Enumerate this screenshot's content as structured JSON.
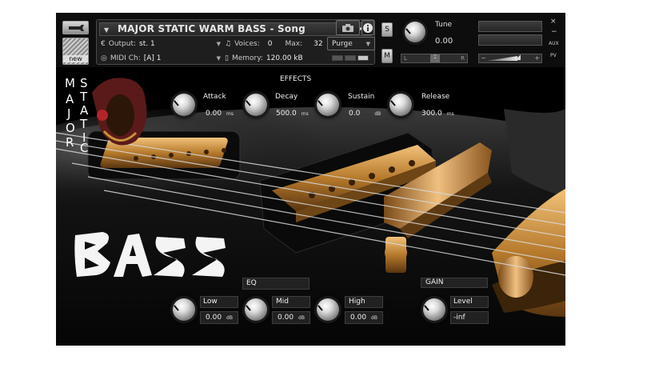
{
  "colors": {
    "accent_gold": "#c8923a",
    "panel_bg": "#1e1e1e",
    "text": "#f0f0f0"
  },
  "header": {
    "wrench_icon": "wrench-icon",
    "new_label": "new",
    "title": "MAJOR STATIC WARM BASS - Song",
    "output_label": "Output:",
    "output_value": "st. 1",
    "voices_label": "Voices:",
    "voices_value": "0",
    "max_label": "Max:",
    "max_value": "32",
    "purge_label": "Purge",
    "midi_label": "MIDI Ch:",
    "midi_value": "[A]  1",
    "memory_label": "Memory:",
    "memory_value": "120.00 kB",
    "solo_label": "S",
    "mute_label": "M",
    "tune_label": "Tune",
    "tune_value": "0.00",
    "pan_left": "L",
    "pan_right": "R",
    "aux_label": "AUX",
    "pv_label": "PV",
    "close_label": "×",
    "minus_label": "−",
    "vol_minus": "−",
    "vol_plus": "+"
  },
  "logo": {
    "left_column": [
      "M",
      "A",
      "J",
      "O",
      "R"
    ],
    "right_column": [
      "S",
      "T",
      "A",
      "T",
      "I",
      "C"
    ],
    "word": "BASS"
  },
  "effects": {
    "section_title": "EFFECTS",
    "attack_label": "Attack",
    "attack_value": "0.00",
    "attack_unit": "ms",
    "decay_label": "Decay",
    "decay_value": "500.0",
    "decay_unit": "ms",
    "sustain_label": "Sustain",
    "sustain_value": "0.0",
    "sustain_unit": "dB",
    "release_label": "Release",
    "release_value": "300.0",
    "release_unit": "ms"
  },
  "eq": {
    "section_title": "EQ",
    "low_label": "Low",
    "low_value": "0.00",
    "low_unit": "dB",
    "mid_label": "Mid",
    "mid_value": "0.00",
    "mid_unit": "dB",
    "high_label": "High",
    "high_value": "0.00",
    "high_unit": "dB"
  },
  "gain": {
    "section_title": "GAIN",
    "level_label": "Level",
    "level_value": "-inf"
  }
}
